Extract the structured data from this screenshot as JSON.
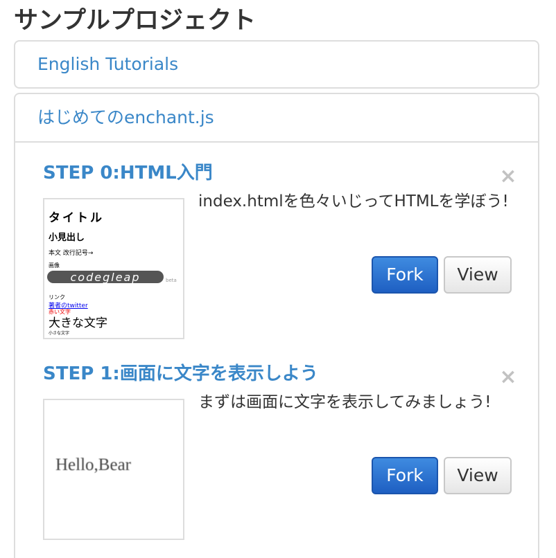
{
  "page": {
    "title": "サンプルプロジェクト"
  },
  "panels": {
    "english": {
      "label": "English Tutorials"
    },
    "enchant": {
      "label": "はじめてのenchant.js"
    }
  },
  "steps": [
    {
      "title": "STEP 0:HTML入門",
      "description": "index.htmlを色々いじってHTMLを学ぼう!",
      "fork_label": "Fork",
      "view_label": "View",
      "close_icon": "close-icon",
      "thumbnail": {
        "heading": "タイトル",
        "subheading": "小見出し",
        "body": "本文 改行記号→",
        "image_label": "画像",
        "logo_text": "codegleap",
        "logo_suffix": "beta",
        "link_label": "リンク",
        "link_text": "著者のtwitter",
        "red_text": "赤い文字",
        "big_text": "大きな文字",
        "small_text": "小さな文字"
      }
    },
    {
      "title": "STEP 1:画面に文字を表示しよう",
      "description": "まずは画面に文字を表示してみましょう!",
      "fork_label": "Fork",
      "view_label": "View",
      "close_icon": "close-icon",
      "thumbnail": {
        "text": "Hello,Bear"
      }
    }
  ],
  "colors": {
    "link": "#3a87c8",
    "primary_button": "#2a6fd3",
    "border": "#dddddd"
  }
}
